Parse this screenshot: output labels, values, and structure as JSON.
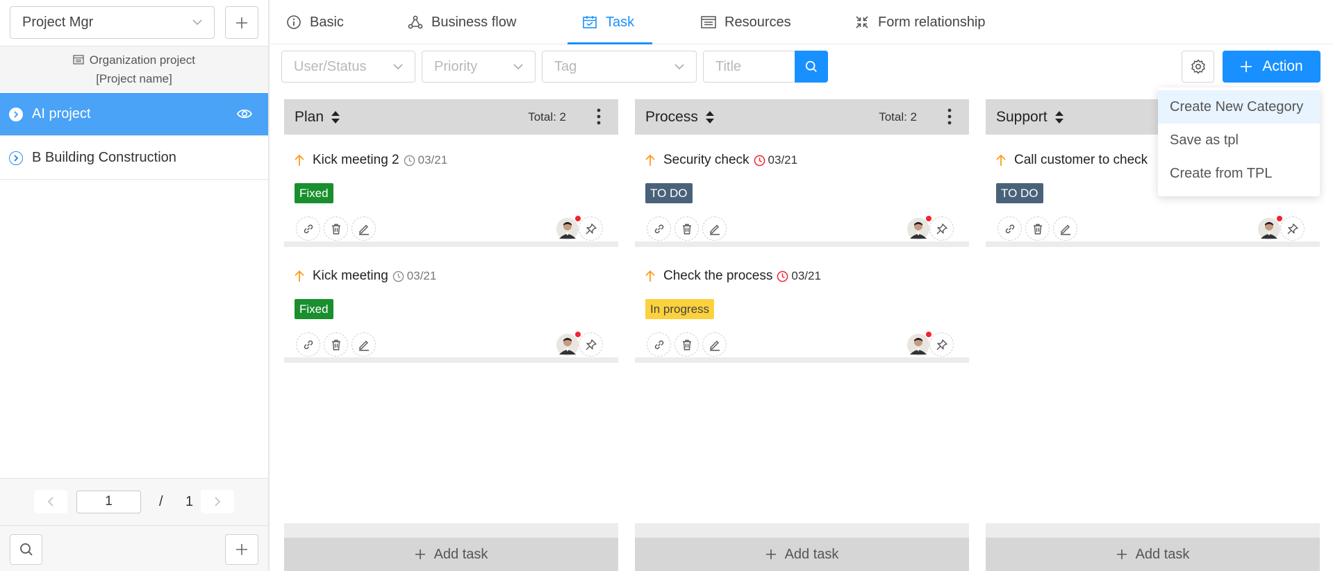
{
  "sidebar": {
    "project_select": "Project Mgr",
    "org_line1": "Organization project",
    "org_line2": "[Project name]",
    "projects": [
      {
        "name": "AI project",
        "active": true
      },
      {
        "name": "B Building Construction",
        "active": false
      }
    ],
    "pager": {
      "current": "1",
      "slash": "/",
      "total": "1"
    }
  },
  "tabs": [
    {
      "label": "Basic",
      "icon": "info-icon"
    },
    {
      "label": "Business flow",
      "icon": "flow-icon"
    },
    {
      "label": "Task",
      "icon": "calendar-check-icon",
      "active": true
    },
    {
      "label": "Resources",
      "icon": "list-icon"
    },
    {
      "label": "Form relationship",
      "icon": "compress-icon"
    }
  ],
  "filters": {
    "user_status": "User/Status",
    "priority": "Priority",
    "tag": "Tag",
    "title": "Title"
  },
  "action_label": "Action",
  "dropdown": [
    "Create New Category",
    "Save as tpl",
    "Create from TPL"
  ],
  "columns": [
    {
      "name": "Plan",
      "total": "Total: 2",
      "cards": [
        {
          "title": "Kick meeting 2",
          "date": "03/21",
          "overdue": false,
          "tag": "Fixed",
          "tag_color": "#198f2e"
        },
        {
          "title": "Kick meeting",
          "date": "03/21",
          "overdue": false,
          "tag": "Fixed",
          "tag_color": "#198f2e"
        }
      ]
    },
    {
      "name": "Process",
      "total": "Total: 2",
      "cards": [
        {
          "title": "Security check",
          "date": "03/21",
          "overdue": true,
          "tag": "TO DO",
          "tag_color": "#4a6279"
        },
        {
          "title": "Check the process",
          "date": "03/21",
          "overdue": true,
          "tag": "In progress",
          "tag_color": "#fbd13e"
        }
      ]
    },
    {
      "name": "Support",
      "total": "",
      "cards": [
        {
          "title": "Call customer to check",
          "date": "",
          "overdue": false,
          "tag": "TO DO",
          "tag_color": "#4a6279"
        }
      ]
    }
  ],
  "add_task_label": "Add task",
  "colors": {
    "primary": "#1890ff",
    "active_item": "#4aa3f7",
    "overdue": "#f5222d",
    "priority_up": "#fa9c1b"
  }
}
